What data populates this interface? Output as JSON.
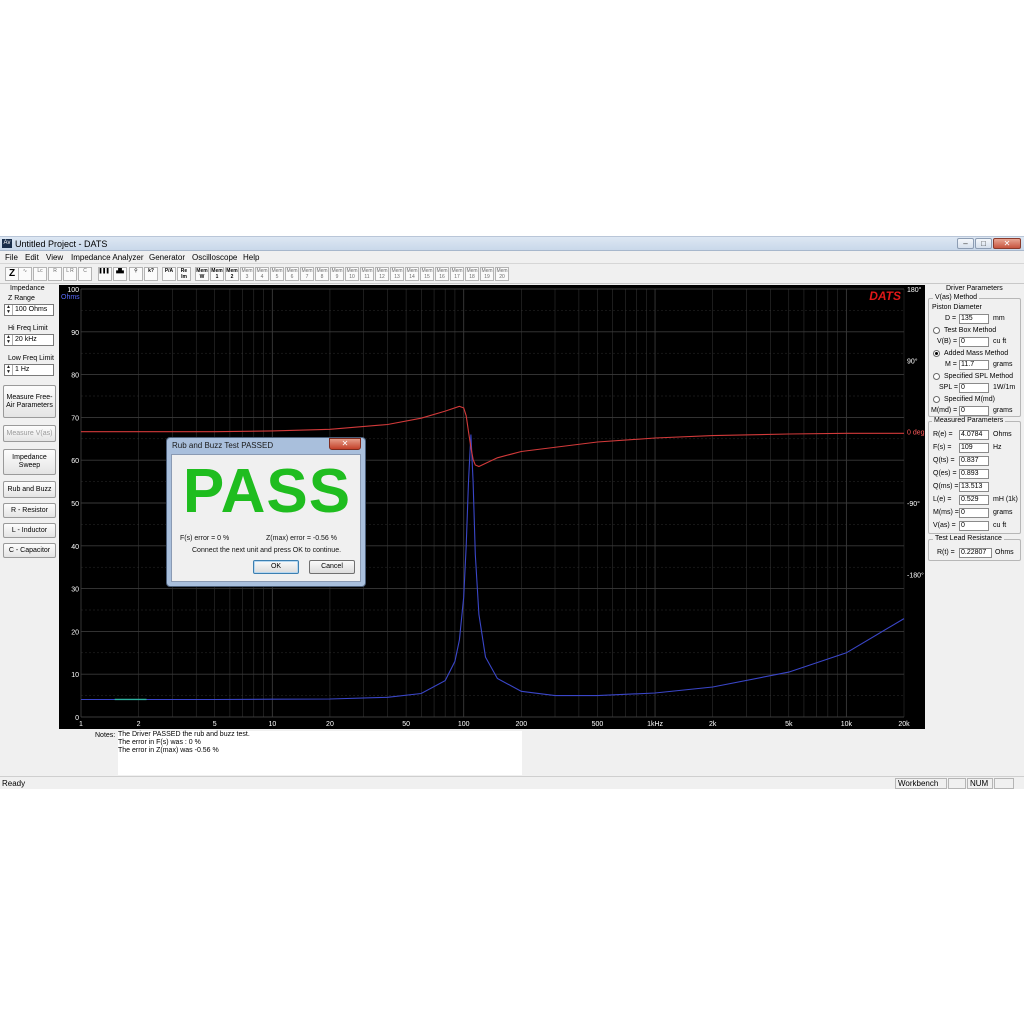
{
  "window": {
    "title": "Untitled Project - DATS",
    "app_icon": "Av"
  },
  "window_controls": {
    "minimize": "–",
    "maximize": "□",
    "close": "✕"
  },
  "menu": [
    "File",
    "Edit",
    "View",
    "Impedance Analyzer",
    "Generator",
    "Oscilloscope",
    "Help"
  ],
  "toolbar": {
    "items": [
      {
        "label": "Z",
        "icon": "impedance-icon"
      },
      {
        "label": "∿",
        "icon": "sine-wave-icon"
      },
      {
        "label": "Lc",
        "icon": "inductor-l-icon"
      },
      {
        "label": "R",
        "icon": "resistor-icon"
      },
      {
        "label": "L R",
        "icon": "l-r-icon"
      },
      {
        "label": "C",
        "icon": "capacitor-icon"
      },
      {
        "label": "▌▌▌",
        "icon": "spectrum-icon"
      },
      {
        "label": "▟▙",
        "icon": "bar-graph-icon"
      },
      {
        "label": "⚲",
        "icon": "probe-icon"
      },
      {
        "label": "k?",
        "icon": "help-pointer-icon"
      },
      {
        "label": "P/A",
        "icon": "phase-icon"
      },
      {
        "label": "Re Im",
        "icon": "complex-icon"
      },
      {
        "label": "Mem W",
        "icon": "memory-w-icon"
      },
      {
        "label": "Mem 1",
        "icon": "memory-1-icon"
      },
      {
        "label": "Mem 2",
        "icon": "memory-2-icon"
      },
      {
        "label": "Mem 3",
        "icon": "memory-3-icon"
      },
      {
        "label": "Mem 4",
        "icon": "memory-4-icon"
      },
      {
        "label": "Mem 5",
        "icon": "memory-5-icon"
      },
      {
        "label": "Mem 6",
        "icon": "memory-6-icon"
      },
      {
        "label": "Mem 7",
        "icon": "memory-7-icon"
      },
      {
        "label": "Mem 8",
        "icon": "memory-8-icon"
      },
      {
        "label": "Mem 9",
        "icon": "memory-9-icon"
      },
      {
        "label": "Mem 10",
        "icon": "memory-10-icon"
      },
      {
        "label": "Mem 11",
        "icon": "memory-11-icon"
      },
      {
        "label": "Mem 12",
        "icon": "memory-12-icon"
      },
      {
        "label": "Mem 13",
        "icon": "memory-13-icon"
      },
      {
        "label": "Mem 14",
        "icon": "memory-14-icon"
      },
      {
        "label": "Mem 15",
        "icon": "memory-15-icon"
      },
      {
        "label": "Mem 16",
        "icon": "memory-16-icon"
      },
      {
        "label": "Mem 17",
        "icon": "memory-17-icon"
      },
      {
        "label": "Mem 18",
        "icon": "memory-18-icon"
      },
      {
        "label": "Mem 19",
        "icon": "memory-19-icon"
      },
      {
        "label": "Mem 20",
        "icon": "memory-20-icon"
      }
    ]
  },
  "left_panel": {
    "group_title": "Impedance",
    "z_range": {
      "label": "Z Range",
      "value": "100 Ohms"
    },
    "hi_freq": {
      "label": "Hi Freq Limit",
      "value": "20 kHz"
    },
    "low_freq": {
      "label": "Low Freq Limit",
      "value": "1 Hz"
    },
    "buttons": {
      "measure_free_air": "Measure Free-Air Parameters",
      "measure_vas": "Measure V(as)",
      "impedance_sweep": "Impedance Sweep",
      "rub_and_buzz": "Rub and Buzz",
      "resistor": "R - Resistor",
      "inductor": "L - Inductor",
      "capacitor": "C - Capacitor"
    }
  },
  "chart_data": {
    "type": "line",
    "logo": "DATS",
    "x_scale": "log",
    "x_ticks": [
      1,
      2,
      5,
      10,
      20,
      50,
      100,
      200,
      500,
      1000,
      2000,
      5000,
      10000,
      20000
    ],
    "x_tick_labels": [
      "1",
      "2",
      "5",
      "10",
      "20",
      "50",
      "100",
      "200",
      "500",
      "1kHz",
      "2k",
      "5k",
      "10k",
      "20k"
    ],
    "y_left_unit": "Ohms",
    "y_left_ticks": [
      0,
      10,
      20,
      30,
      40,
      50,
      60,
      70,
      80,
      90,
      100
    ],
    "y_left_tick_labels": [
      "0",
      "10",
      "20",
      "30",
      "40",
      "50",
      "60",
      "70",
      "80",
      "90",
      "100"
    ],
    "y_left_range": [
      0,
      100
    ],
    "y_right_ticks": [
      180,
      90,
      0,
      -90,
      -180
    ],
    "y_right_tick_labels": [
      "180°",
      "90°",
      "0 deg",
      "-90°",
      "-180°"
    ],
    "y_right_range": [
      -360,
      180
    ],
    "grid": true,
    "colors": {
      "impedance": "#3a46c8",
      "phase": "#d23a3a",
      "background": "#000000",
      "grid": "#3a3a3a",
      "logo": "#e01818",
      "marker": "#2db0a0"
    },
    "series": [
      {
        "role": "impedance",
        "axis": "left",
        "x": [
          1,
          2,
          5,
          10,
          20,
          40,
          60,
          80,
          90,
          95,
          100,
          103,
          106,
          109,
          112,
          115,
          120,
          130,
          150,
          200,
          300,
          500,
          1000,
          2000,
          5000,
          10000,
          20000
        ],
        "y": [
          4.1,
          4.1,
          4.1,
          4.15,
          4.2,
          4.6,
          5.5,
          8.5,
          13,
          18,
          28,
          40,
          55,
          66,
          55,
          38,
          24,
          14,
          9,
          6,
          5,
          5,
          5.6,
          7,
          10.5,
          15,
          23
        ]
      },
      {
        "role": "phase",
        "axis": "right",
        "x": [
          1,
          5,
          10,
          20,
          40,
          60,
          80,
          95,
          100,
          103,
          106,
          109,
          112,
          115,
          120,
          130,
          150,
          200,
          500,
          1000,
          2000,
          5000,
          10000,
          20000
        ],
        "y": [
          0,
          0,
          1,
          3,
          9,
          17,
          26,
          32,
          30,
          20,
          0,
          -20,
          -35,
          -42,
          -44,
          -40,
          -33,
          -25,
          -13,
          -8,
          -5,
          -3,
          -2,
          -2
        ]
      }
    ],
    "marker": {
      "x_range": [
        1.5,
        2.2
      ],
      "y": 4.1
    }
  },
  "right_panel": {
    "title": "Driver Parameters",
    "vas_method": "V(as) Method",
    "piston_diameter": "Piston Diameter",
    "d": {
      "label": "D =",
      "value": "135",
      "unit": "mm"
    },
    "test_box": {
      "label": "Test Box Method"
    },
    "vb": {
      "label": "V(B) =",
      "value": "0",
      "unit": "cu ft"
    },
    "added_mass": {
      "label": "Added Mass Method"
    },
    "m": {
      "label": "M =",
      "value": "11.7",
      "unit": "grams"
    },
    "spl": {
      "label": "Specified SPL Method"
    },
    "spl_field": {
      "label": "SPL =",
      "value": "0",
      "unit": "1W/1m"
    },
    "mmd_method": {
      "label": "Specified M(md)"
    },
    "mmd": {
      "label": "M(md) =",
      "value": "0",
      "unit": "grams"
    },
    "measured_title": "Measured Parameters",
    "measured": [
      {
        "label": "R(e) =",
        "value": "4.0784",
        "unit": "Ohms"
      },
      {
        "label": "F(s) =",
        "value": "109",
        "unit": "Hz"
      },
      {
        "label": "Q(ts) =",
        "value": "0.837",
        "unit": ""
      },
      {
        "label": "Q(es) =",
        "value": "0.893",
        "unit": ""
      },
      {
        "label": "Q(ms) =",
        "value": "13.513",
        "unit": ""
      },
      {
        "label": "L(e) =",
        "value": "0.529",
        "unit": "mH (1k)"
      },
      {
        "label": "M(ms) =",
        "value": "0",
        "unit": "grams"
      },
      {
        "label": "V(as) =",
        "value": "0",
        "unit": "cu ft"
      }
    ],
    "lead_title": "Test Lead Resistance",
    "lead": {
      "label": "R(t) =",
      "value": "0.22807",
      "unit": "Ohms"
    }
  },
  "notes": {
    "label": "Notes:",
    "lines": [
      "The Driver PASSED the rub and buzz test.",
      "The error in F(s) was : 0 %",
      "The error in Z(max) was -0.56 %"
    ]
  },
  "status": {
    "ready": "Ready",
    "workbench": "Workbench",
    "num": "NUM"
  },
  "dialog": {
    "title": "Rub and Buzz Test PASSED",
    "close": "✕",
    "headline": "PASS",
    "headline_color": "#1fbd1f",
    "fs_error": "F(s) error =   0 %",
    "zmax_error": "Z(max) error = -0.56 %",
    "message": "Connect the next unit and press OK to continue.",
    "ok": "OK",
    "cancel": "Cancel"
  }
}
